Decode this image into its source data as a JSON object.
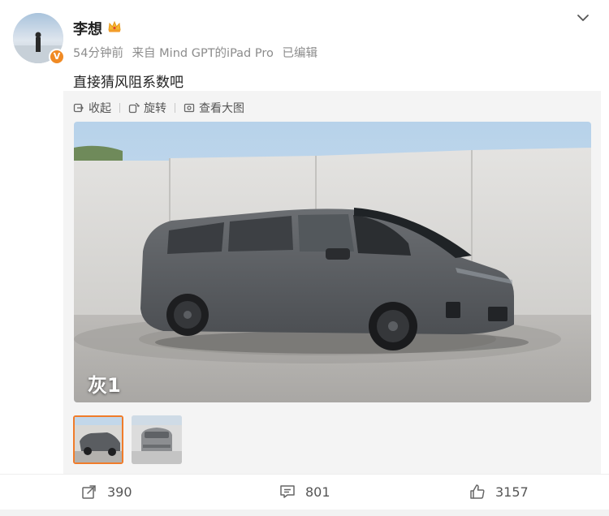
{
  "post": {
    "username": "李想",
    "time": "54分钟前",
    "source": "来自 Mind GPT的iPad Pro",
    "edited": "已编辑",
    "text": "直接猜风阻系数吧",
    "verified_mark": "V"
  },
  "toolbar": {
    "collapse_label": "收起",
    "rotate_label": "旋转",
    "view_large_label": "查看大图"
  },
  "image": {
    "caption": "灰1"
  },
  "actions": {
    "repost_count": "390",
    "comment_count": "801",
    "like_count": "3157"
  },
  "colors": {
    "accent": "#f07c2a",
    "verified_badge": "#f08a24",
    "text_primary": "#222222",
    "text_secondary": "#8c8c8c",
    "media_bg": "#f4f4f4"
  },
  "icons": {
    "crown": "crown-icon",
    "menu": "chevron-down-icon",
    "repost": "share-icon",
    "comment": "comment-icon",
    "like": "thumbs-up-icon"
  }
}
